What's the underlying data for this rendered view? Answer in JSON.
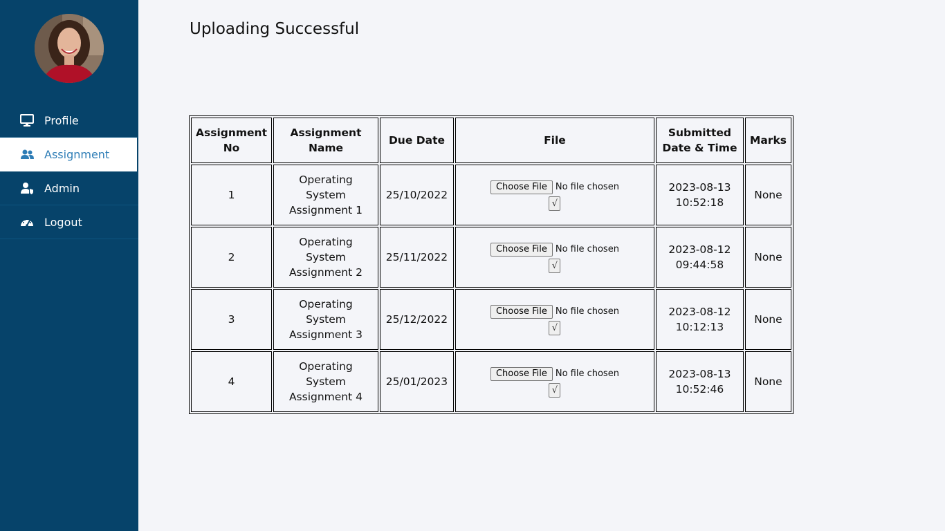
{
  "sidebar": {
    "nav": [
      {
        "label": "Profile",
        "icon": "monitor-icon",
        "active": false
      },
      {
        "label": "Assignment",
        "icon": "users-icon",
        "active": true
      },
      {
        "label": "Admin",
        "icon": "admin-user-icon",
        "active": false
      },
      {
        "label": "Logout",
        "icon": "dashboard-gauge-icon",
        "active": false
      }
    ]
  },
  "page": {
    "title": "Uploading Successful"
  },
  "table": {
    "headers": {
      "no": "Assignment No",
      "name": "Assignment Name",
      "due": "Due Date",
      "file": "File",
      "submitted": "Submitted Date & Time",
      "marks": "Marks"
    },
    "file_button": "Choose File",
    "file_status": "No file chosen",
    "submit_glyph": "√",
    "rows": [
      {
        "no": "1",
        "name": "Operating System Assignment 1",
        "due": "25/10/2022",
        "submitted": "2023-08-13 10:52:18",
        "marks": "None"
      },
      {
        "no": "2",
        "name": "Operating System Assignment 2",
        "due": "25/11/2022",
        "submitted": "2023-08-12 09:44:58",
        "marks": "None"
      },
      {
        "no": "3",
        "name": "Operating System Assignment 3",
        "due": "25/12/2022",
        "submitted": "2023-08-12 10:12:13",
        "marks": "None"
      },
      {
        "no": "4",
        "name": "Operating System Assignment 4",
        "due": "25/01/2023",
        "submitted": "2023-08-13 10:52:46",
        "marks": "None"
      }
    ]
  },
  "colors": {
    "sidebar_bg": "#06436a",
    "active_text": "#2e7db6",
    "page_bg": "#f4f5f9"
  }
}
